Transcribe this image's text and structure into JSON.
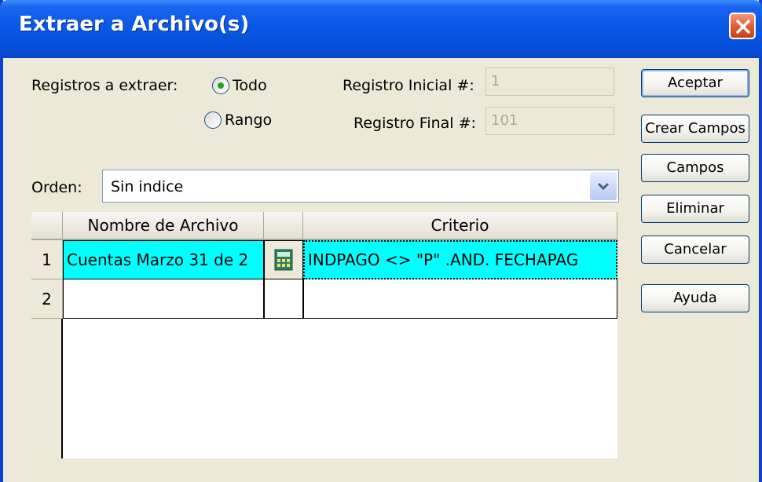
{
  "window": {
    "title": "Extraer a Archivo(s)"
  },
  "form": {
    "records_label": "Registros a extraer:",
    "radio_all": "Todo",
    "radio_range": "Rango",
    "start_label": "Registro Inicial #:",
    "start_value": "1",
    "end_label": "Registro Final #:",
    "end_value": "101",
    "order_label": "Orden:",
    "order_value": "Sin indice"
  },
  "buttons": {
    "accept": "Aceptar",
    "create_fields": "Crear Campos",
    "fields": "Campos",
    "delete": "Eliminar",
    "cancel": "Cancelar",
    "help": "Ayuda"
  },
  "grid": {
    "headers": {
      "filename": "Nombre de Archivo",
      "criteria": "Criterio"
    },
    "rows": [
      {
        "num": "1",
        "filename": "Cuentas Marzo 31 de 2",
        "criteria": "INDPAGO <> \"P\"  .AND. FECHAPAG",
        "icon": "calculator-icon"
      },
      {
        "num": "2",
        "filename": "",
        "criteria": "",
        "icon": ""
      }
    ]
  },
  "colors": {
    "titlebar": "#0A58E6",
    "selected_row": "#00FFFF",
    "radio_dot": "#21A121",
    "close": "#DF5B33"
  }
}
